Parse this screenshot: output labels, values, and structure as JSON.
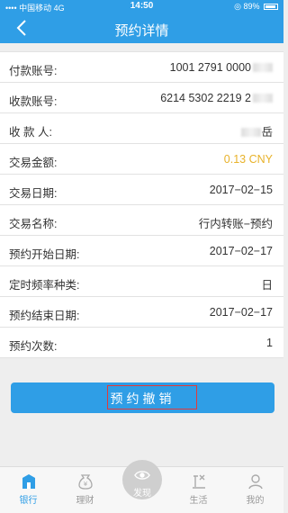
{
  "statusbar": {
    "carrier": "中国移动",
    "network": "4G",
    "time": "14:50",
    "battery": "89%"
  },
  "navbar": {
    "title": "预约详情"
  },
  "details": [
    {
      "label": "付款账号:",
      "value": "1001 2791 0000",
      "masked": true
    },
    {
      "label": "收款账号:",
      "value": "6214 5302 2219 2",
      "masked": true
    },
    {
      "label": "收 款 人:",
      "value": "岳",
      "masked": true
    },
    {
      "label": "交易金额:",
      "value": "0.13 CNY",
      "amount": true
    },
    {
      "label": "交易日期:",
      "value": "2017−02−15"
    },
    {
      "label": "交易名称:",
      "value": "行内转账−预约"
    },
    {
      "label": "预约开始日期:",
      "value": "2017−02−17"
    },
    {
      "label": "定时频率种类:",
      "value": "日"
    },
    {
      "label": "预约结束日期:",
      "value": "2017−02−17"
    },
    {
      "label": "预约次数:",
      "value": "1"
    }
  ],
  "cancel_button": {
    "label": "预约撤销"
  },
  "tabbar": {
    "tabs": [
      {
        "label": "银行",
        "icon": "bank-icon",
        "active": true
      },
      {
        "label": "理财",
        "icon": "wealth-icon"
      },
      {
        "label": "发现",
        "icon": "eye-icon"
      },
      {
        "label": "生活",
        "icon": "life-icon"
      },
      {
        "label": "我的",
        "icon": "user-icon"
      }
    ]
  },
  "colors": {
    "primary": "#2f9ee6",
    "amount": "#e8b22a",
    "highlight_box": "#e23a3a"
  }
}
